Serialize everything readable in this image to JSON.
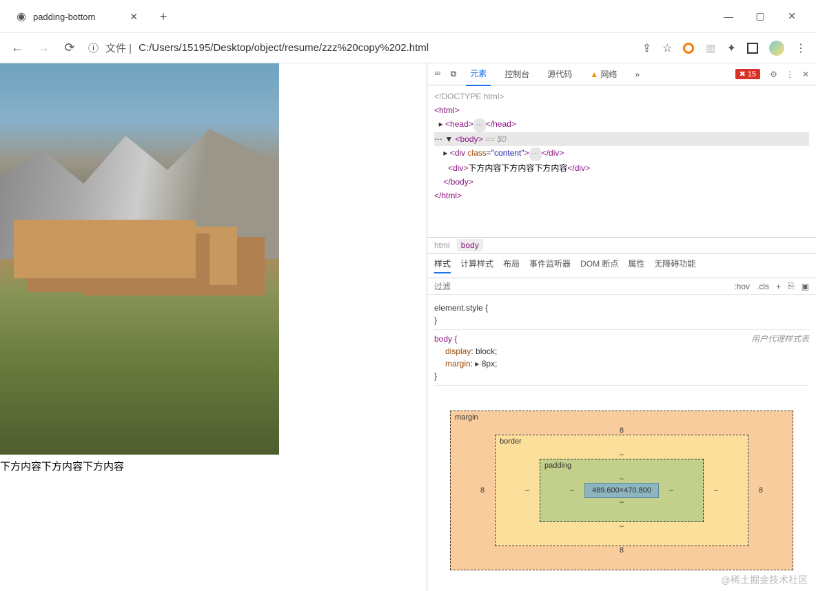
{
  "tab": {
    "title": "padding-bottom"
  },
  "url": {
    "prefix": "文件 |",
    "path": "C:/Users/15195/Desktop/object/resume/zzz%20copy%202.html"
  },
  "page": {
    "below_text": "下方内容下方内容下方内容"
  },
  "devtools": {
    "panels": [
      "元素",
      "控制台",
      "源代码",
      "网络"
    ],
    "network_warn": true,
    "error_count": "15",
    "dom": {
      "doctype": "<!DOCTYPE html>",
      "body_hint": "== $0",
      "content_div_text": "下方内容下方内容下方内容",
      "content_class": "content"
    },
    "crumbs": [
      "html",
      "body"
    ],
    "style_tabs": [
      "样式",
      "计算样式",
      "布局",
      "事件监听器",
      "DOM 断点",
      "属性",
      "无障碍功能"
    ],
    "filter_placeholder": "过滤",
    "filter_controls": [
      ":hov",
      ".cls",
      "+"
    ],
    "rules": {
      "element_style": "element.style {",
      "body_selector": "body {",
      "body_origin": "用户代理样式表",
      "body_props": [
        {
          "prop": "display",
          "val": "block"
        },
        {
          "prop": "margin",
          "val": "8px",
          "expandable": true
        }
      ]
    },
    "box_model": {
      "margin": {
        "label": "margin",
        "t": "8",
        "r": "8",
        "b": "8",
        "l": "8"
      },
      "border": {
        "label": "border",
        "t": "–",
        "r": "–",
        "b": "–",
        "l": "–"
      },
      "padding": {
        "label": "padding",
        "t": "–",
        "r": "–",
        "b": "–",
        "l": "–"
      },
      "content": "489.600×470.800"
    }
  },
  "watermark": "@稀土掘金技术社区"
}
